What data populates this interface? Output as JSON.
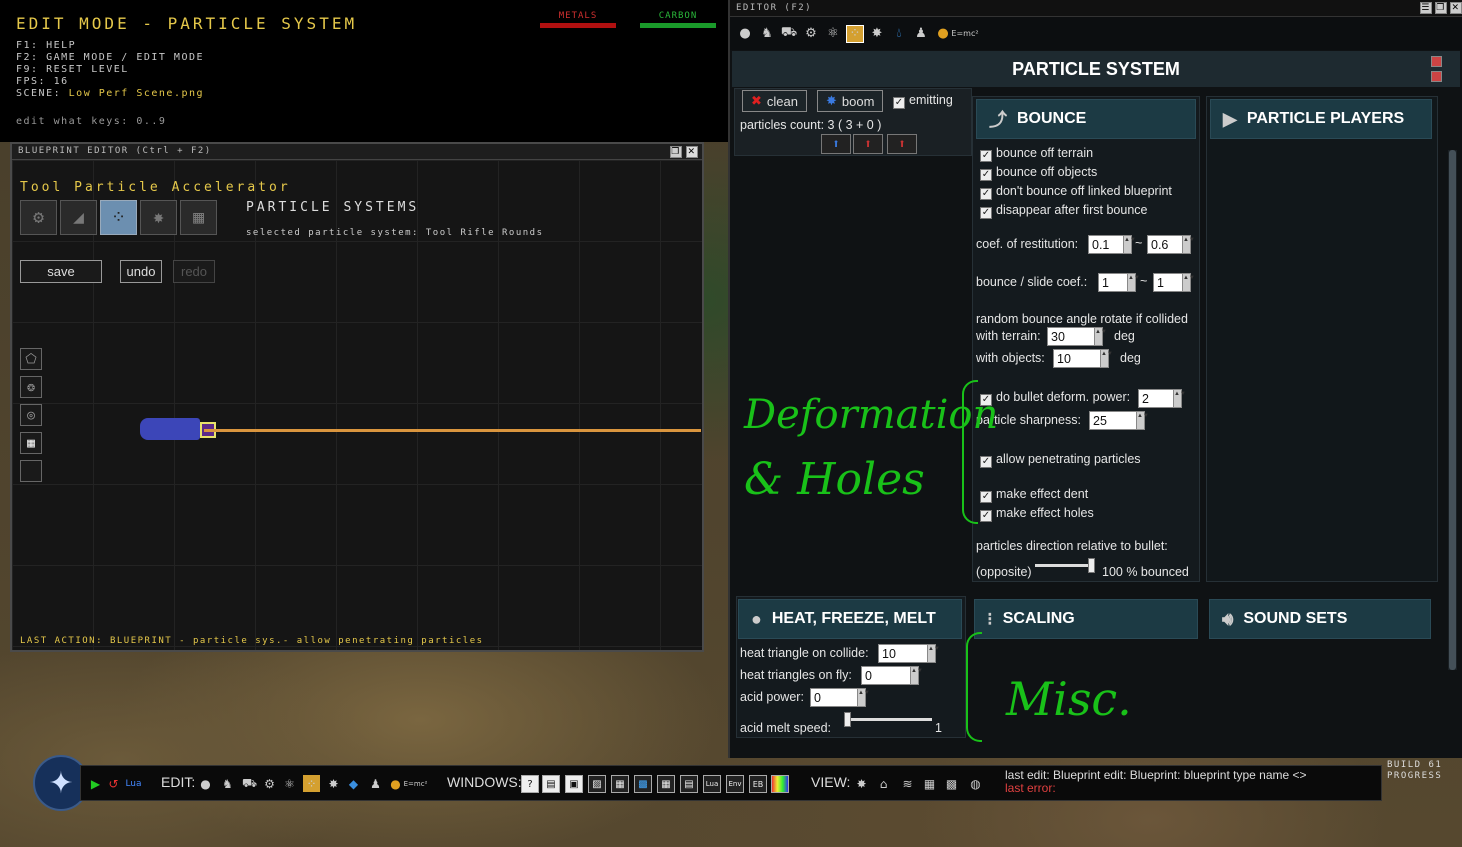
{
  "hud": {
    "title": "EDIT MODE - PARTICLE SYSTEM",
    "help": "F1: HELP",
    "f2": "F2: GAME MODE / EDIT MODE",
    "f9": "F9: RESET LEVEL",
    "fps_label": "FPS:",
    "fps_value": "16",
    "scene_label": "SCENE:",
    "scene_value": "Low Perf Scene.png",
    "edit_keys": "edit what keys: 0..9",
    "metals_label": "METALS",
    "carbon_label": "CARBON",
    "metals_color": "#b01010",
    "carbon_color": "#1a9a2a"
  },
  "blueprint_editor": {
    "title": "BLUEPRINT EDITOR (Ctrl + F2)",
    "name": "Tool Particle Accelerator",
    "section_title": "PARTICLE SYSTEMS",
    "selected_label": "selected particle system: Tool Rifle Rounds",
    "save": "save",
    "undo": "undo",
    "redo": "redo",
    "last_action": "LAST ACTION: BLUEPRINT - particle sys.- allow penetrating particles"
  },
  "editor": {
    "title": "EDITOR (F2)",
    "header": "PARTICLE SYSTEM",
    "clean": "clean",
    "boom": "boom",
    "emitting": "emitting",
    "particles_count": "particles count: 3 ( 3 + 0 )",
    "bounce": {
      "title": "BOUNCE",
      "terrain": "bounce off terrain",
      "objects": "bounce off objects",
      "linked": "don't bounce off linked blueprint",
      "disappear": "disappear after first bounce",
      "restitution_label": "coef. of restitution:",
      "restitution_min": "0.1",
      "restitution_max": "0.6",
      "slide_label": "bounce / slide coef.:",
      "slide_min": "1",
      "slide_max": "1",
      "random_label": "random bounce angle rotate if collided",
      "with_terrain_label": "with terrain:",
      "with_terrain_value": "30",
      "with_objects_label": "with objects:",
      "with_objects_value": "10",
      "deg": "deg",
      "deform_label": "do bullet deform. power:",
      "deform_value": "2",
      "sharpness_label": "particle sharpness:",
      "sharpness_value": "25",
      "penetrating": "allow penetrating particles",
      "dent": "make effect dent",
      "holes": "make effect holes",
      "direction_label": "particles direction relative to bullet:",
      "opposite": "(opposite)",
      "bounced": "100 % bounced",
      "bounced_fraction": 1.0,
      "tilde": "~"
    },
    "particle_players": "PARTICLE PLAYERS",
    "heat": {
      "title": "HEAT, FREEZE, MELT",
      "collide_label": "heat triangle on collide:",
      "collide_value": "10",
      "fly_label": "heat triangles on fly:",
      "fly_value": "0",
      "acid_label": "acid power:",
      "acid_value": "0",
      "melt_label": "acid melt speed:",
      "melt_value": "1",
      "melt_fraction": 0.0
    },
    "scaling": "SCALING",
    "sound_sets": "SOUND SETS"
  },
  "annotations": {
    "deform": "Deformation",
    "holes": "& Holes",
    "misc": "Misc."
  },
  "bottom_bar": {
    "edit_label": "EDIT:",
    "windows_label": "WINDOWS:",
    "view_label": "VIEW:",
    "last_edit": "last edit: Blueprint edit: Blueprint: blueprint type name <>",
    "last_error": "last error:",
    "build": "BUILD 61",
    "progress": "PROGRESS"
  }
}
